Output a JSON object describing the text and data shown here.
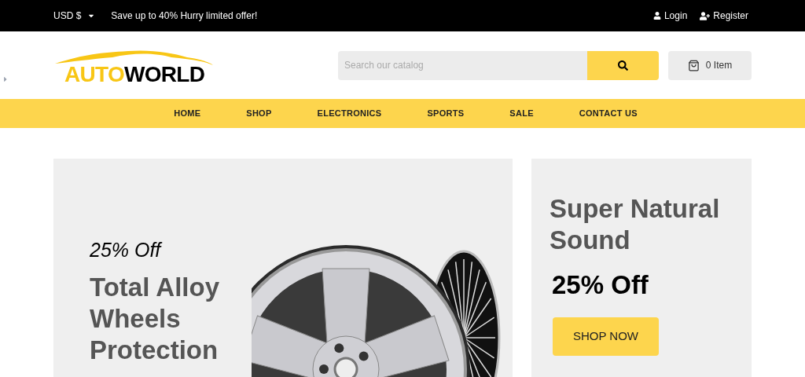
{
  "top_bar": {
    "currency": "USD $",
    "offer": "Save up to 40% Hurry limited offer!",
    "links": [
      {
        "kind": "login",
        "label": "Login"
      },
      {
        "kind": "register",
        "label": "Register"
      }
    ]
  },
  "header": {
    "logo": {
      "part_1": "AUTO",
      "part_2": "WORLD"
    },
    "search": {
      "placeholder": "Search our catalog"
    },
    "cart": {
      "label": "0 Item"
    }
  },
  "nav": [
    {
      "label": "HOME"
    },
    {
      "label": "SHOP"
    },
    {
      "label": "ELECTRONICS"
    },
    {
      "label": "SPORTS"
    },
    {
      "label": "SALE"
    },
    {
      "label": "CONTACT US"
    }
  ],
  "main_banner": {
    "discount": "25% Off",
    "title_lines": [
      "Total Alloy",
      "Wheels",
      "Protection"
    ]
  },
  "side_banner": {
    "title": "Super Natural Sound",
    "discount": "25% Off",
    "button": "SHOP NOW"
  }
}
